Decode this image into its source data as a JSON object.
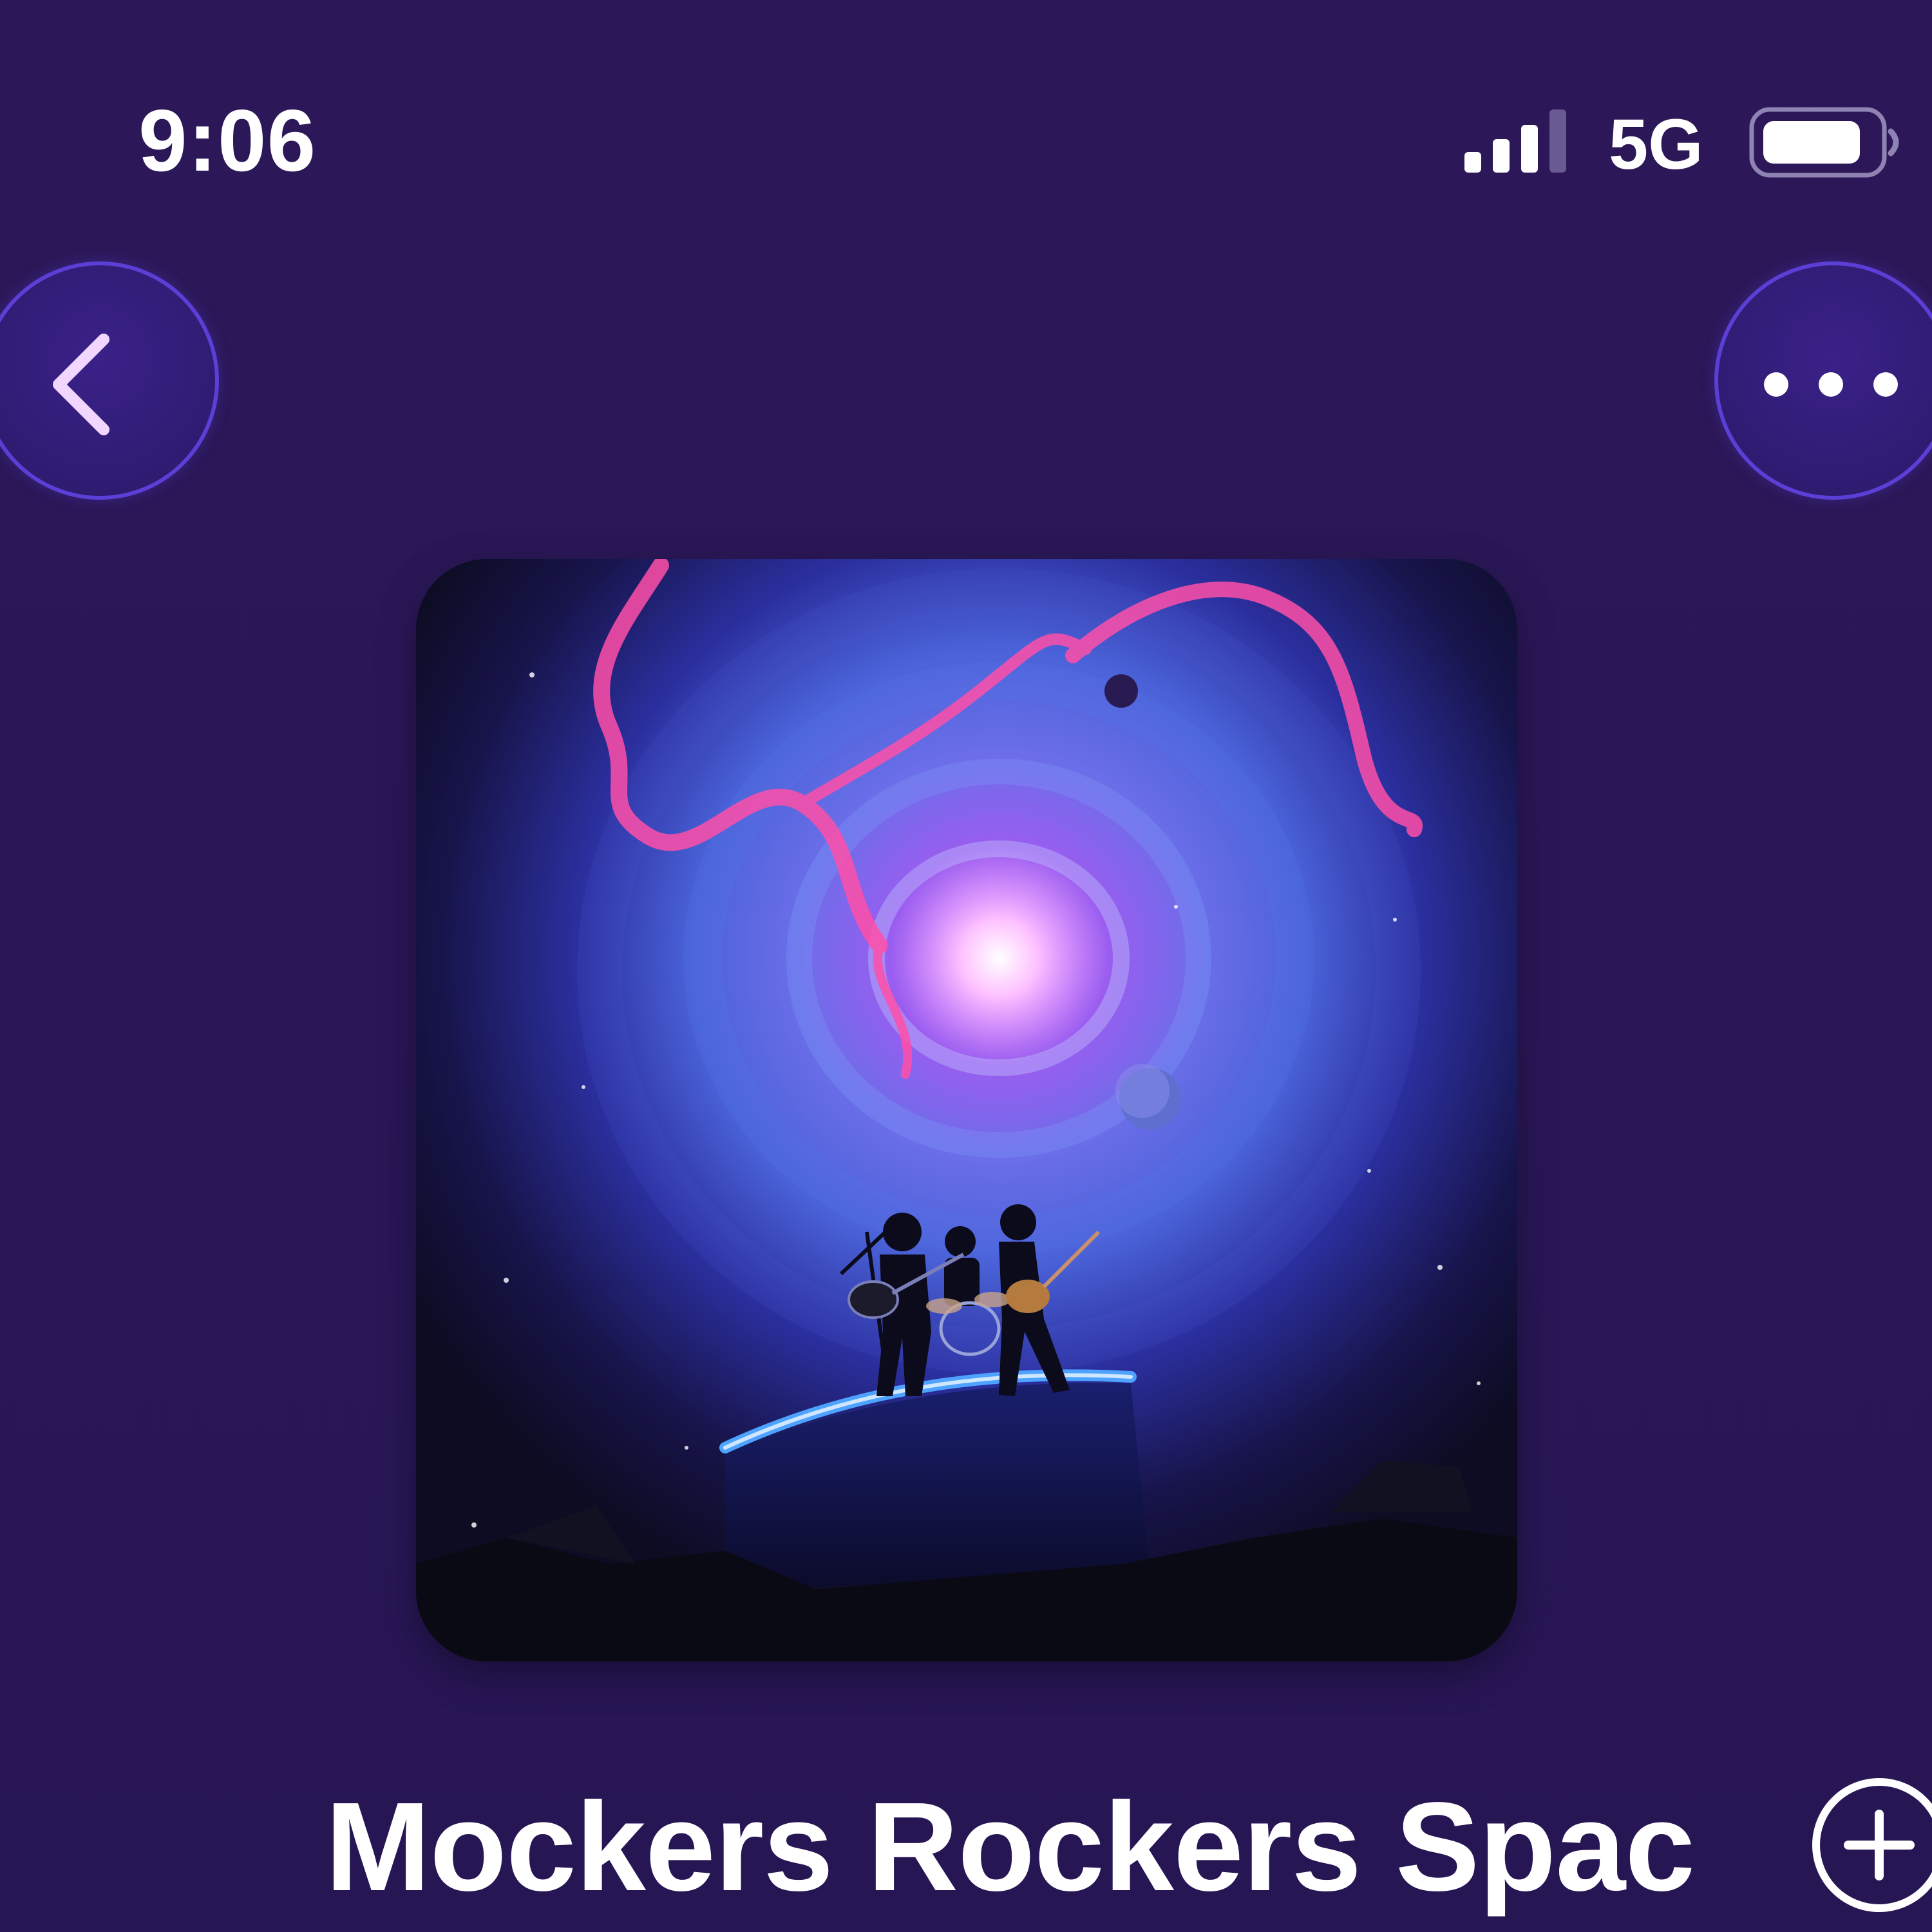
{
  "status_bar": {
    "time": "9:06",
    "network": "5G",
    "signal_bars_active": 3,
    "signal_bars_total": 4,
    "battery_level": 0.85
  },
  "nav": {
    "back_icon": "chevron-left-icon",
    "more_icon": "ellipsis-icon"
  },
  "playlist": {
    "title": "Mockers Rockers Spac",
    "add_icon": "plus-circle-icon"
  },
  "colors": {
    "background": "#2a1857",
    "button_ring": "#5b3fd6",
    "text": "#ffffff"
  }
}
